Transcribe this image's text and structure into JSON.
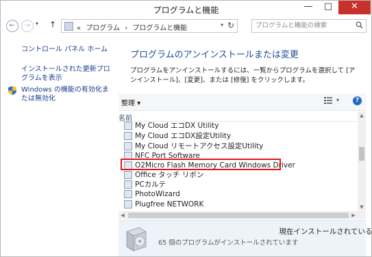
{
  "window": {
    "title": "プログラムと機能",
    "minimize": "—",
    "maximize": "□",
    "close": "✕"
  },
  "nav": {
    "back": "←",
    "forward": "→",
    "up": "↑",
    "breadcrumbs": [
      "«",
      "プログラム",
      "›",
      "プログラムと機能"
    ],
    "dropdown": "▾",
    "refresh": "↻",
    "search_placeholder": "プログラムと機能の検索",
    "search_icon": "search-icon"
  },
  "sidebar": {
    "home": "コントロール パネル ホーム",
    "updates": "インストールされた更新プログラムを表示",
    "features": "Windows の機能の有効化または無効化"
  },
  "main": {
    "heading": "プログラムのアンインストールまたは変更",
    "description": "プログラムをアンインストールするには、一覧からプログラムを選択して [アンインストール]、[変更]、または [修復] をクリックします。"
  },
  "toolbar": {
    "organize": "整理 ▾",
    "view_dropdown": "▾",
    "help": "?"
  },
  "list": {
    "column_name": "名前",
    "items": [
      "My Cloud エコDX Utility",
      "My Cloud エコDX設定Utility",
      "My Cloud リモートアクセス設定Utility",
      "NFC Port Software",
      "O2Micro Flash Memory Card Windows Driver",
      "Office タッチ リボン",
      "PCカルテ",
      "PhotoWizard",
      "Plugfree NETWORK"
    ],
    "highlighted_item": "O2Micro Flash Memory Card Windows Driver"
  },
  "details": {
    "title": "現在インストールされているプログラム",
    "count_text": "65 個のプログラムがインストールされています"
  },
  "colors": {
    "link": "#1a3c8a",
    "heading": "#1e4c9a",
    "highlight_border": "#e0141e",
    "close_button": "#c7312b",
    "details_bg": "#eef3fa"
  }
}
